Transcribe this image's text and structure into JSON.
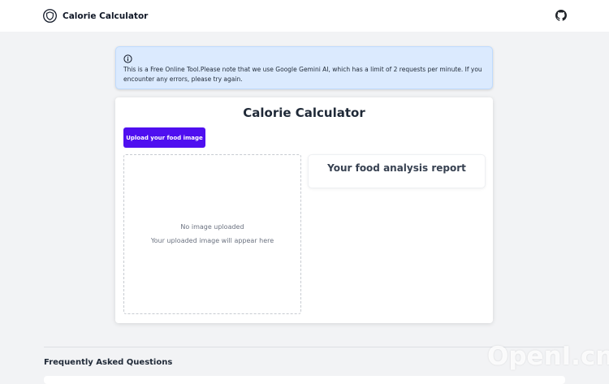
{
  "header": {
    "app_title": "Calorie Calculator",
    "logo_icon": "shield-heart-icon",
    "github_icon": "github-icon"
  },
  "notice": {
    "icon": "info-icon",
    "text": "This is a Free Online Tool.Please note that we use Google Gemini AI, which has a limit of 2 requests per minute. If you encounter any errors, please try again."
  },
  "main": {
    "title": "Calorie Calculator",
    "upload_button_label": "Upload your food image",
    "dropzone": {
      "empty_title": "No image uploaded",
      "empty_hint": "Your uploaded image will appear here"
    },
    "report": {
      "title": "Your food analysis report"
    }
  },
  "faq": {
    "title": "Frequently Asked Questions"
  },
  "watermark": {
    "text": "OpenI.cn"
  },
  "colors": {
    "accent": "#4f0ff0",
    "notice_bg": "#dbeafe",
    "page_bg": "#f2f3f5"
  }
}
